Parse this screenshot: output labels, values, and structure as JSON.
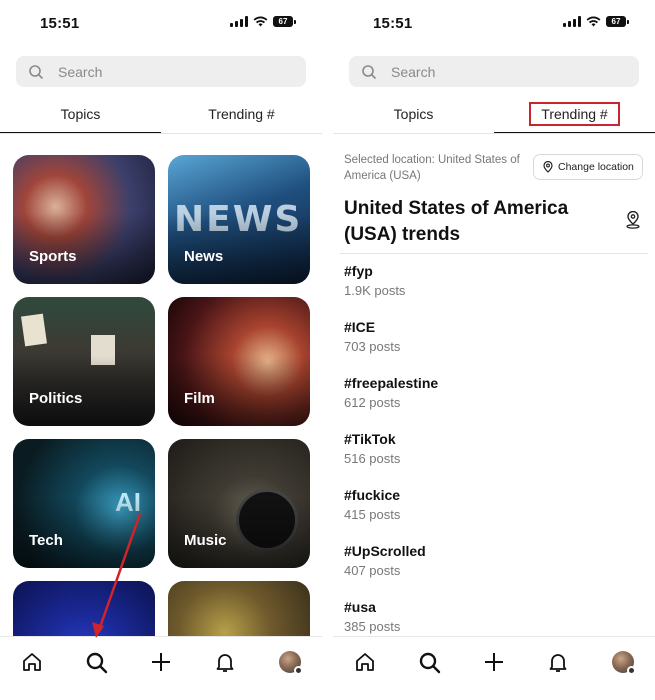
{
  "left": {
    "status": {
      "time": "15:51",
      "battery": "67"
    },
    "search": {
      "placeholder": "Search"
    },
    "tabs": [
      {
        "label": "Topics",
        "active": true
      },
      {
        "label": "Trending #",
        "active": false
      }
    ],
    "topics": [
      {
        "label": "Sports"
      },
      {
        "label": "News"
      },
      {
        "label": "Politics"
      },
      {
        "label": "Film"
      },
      {
        "label": "Tech"
      },
      {
        "label": "Music"
      },
      {
        "label": ""
      },
      {
        "label": ""
      }
    ],
    "nav": [
      "home-icon",
      "search-icon",
      "plus-icon",
      "bell-icon",
      "avatar"
    ]
  },
  "right": {
    "status": {
      "time": "15:51",
      "battery": "67"
    },
    "search": {
      "placeholder": "Search"
    },
    "tabs": [
      {
        "label": "Topics",
        "active": false
      },
      {
        "label": "Trending #",
        "active": true
      }
    ],
    "location_text": "Selected location: United States of America (USA)",
    "change_location": "Change location",
    "title": "United States of America (USA) trends",
    "trends": [
      {
        "tag": "#fyp",
        "count": "1.9K posts"
      },
      {
        "tag": "#ICE",
        "count": "703 posts"
      },
      {
        "tag": "#freepalestine",
        "count": "612 posts"
      },
      {
        "tag": "#TikTok",
        "count": "516 posts"
      },
      {
        "tag": "#fuckice",
        "count": "415 posts"
      },
      {
        "tag": "#UpScrolled",
        "count": "407 posts"
      },
      {
        "tag": "#usa",
        "count": "385 posts"
      }
    ]
  },
  "colors": {
    "highlight_box": "#c8262e",
    "arrow": "#d0232a"
  }
}
